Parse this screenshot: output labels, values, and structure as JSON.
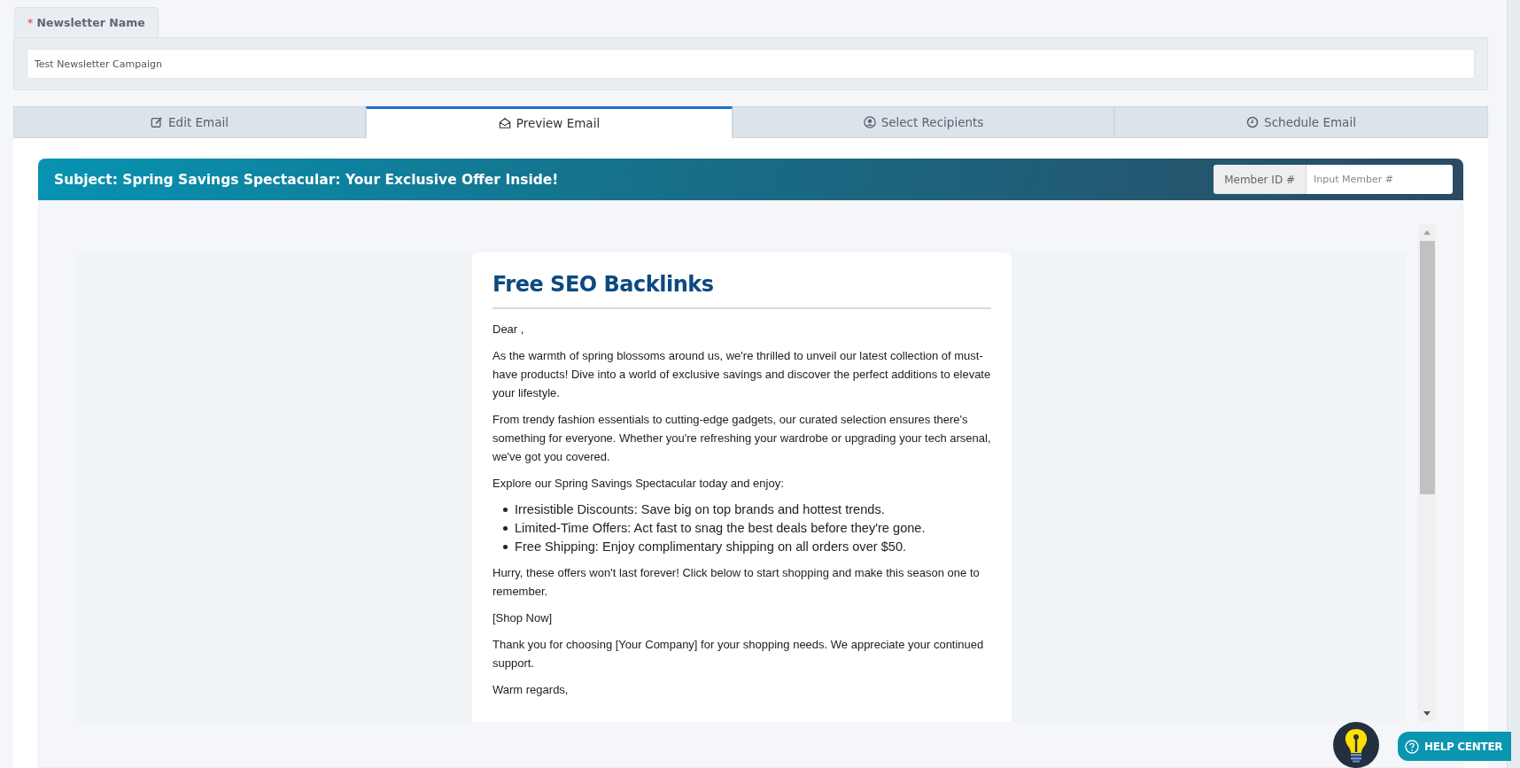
{
  "newsletter_name": {
    "required_mark": "*",
    "label": "Newsletter Name",
    "value": "Test Newsletter Campaign"
  },
  "tabs": [
    {
      "label": "Edit Email",
      "selected": false
    },
    {
      "label": "Preview Email",
      "selected": true
    },
    {
      "label": "Select Recipients",
      "selected": false
    },
    {
      "label": "Schedule Email",
      "selected": false
    }
  ],
  "subject": "Subject: Spring Savings Spectacular: Your Exclusive Offer Inside!",
  "member_id": {
    "label": "Member ID #",
    "placeholder": "Input Member #"
  },
  "email": {
    "title": "Free SEO Backlinks",
    "blocks": [
      {
        "kind": "paragraph",
        "text": "Dear ,"
      },
      {
        "kind": "paragraph",
        "text": "As the warmth of spring blossoms around us, we're thrilled to unveil our latest collection of must-have products! Dive into a world of exclusive savings and discover the perfect additions to elevate your lifestyle."
      },
      {
        "kind": "paragraph",
        "text": "From trendy fashion essentials to cutting-edge gadgets, our curated selection ensures there's something for everyone. Whether you're refreshing your wardrobe or upgrading your tech arsenal, we've got you covered."
      },
      {
        "kind": "paragraph",
        "text": "Explore our Spring Savings Spectacular today and enjoy:"
      },
      {
        "kind": "list",
        "items": [
          "Irresistible Discounts: Save big on top brands and hottest trends.",
          "Limited-Time Offers: Act fast to snag the best deals before they're gone.",
          "Free Shipping: Enjoy complimentary shipping on all orders over $50."
        ]
      },
      {
        "kind": "paragraph",
        "text": "Hurry, these offers won't last forever! Click below to start shopping and make this season one to remember."
      },
      {
        "kind": "paragraph",
        "text": "[Shop Now]"
      },
      {
        "kind": "paragraph",
        "text": "Thank you for choosing [Your Company] for your shopping needs. We appreciate your continued support."
      },
      {
        "kind": "paragraph",
        "text": "Warm regards,"
      }
    ]
  },
  "help_center": {
    "label": "HELP CENTER"
  }
}
